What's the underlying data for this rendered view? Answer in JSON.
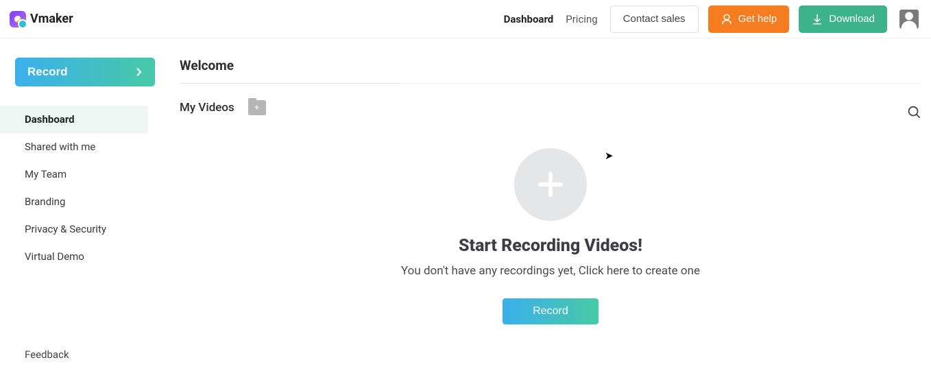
{
  "brand": {
    "name": "Vmaker"
  },
  "topnav": {
    "links": [
      {
        "label": "Dashboard",
        "active": true
      },
      {
        "label": "Pricing",
        "active": false
      }
    ],
    "contact_label": "Contact sales",
    "help_label": "Get help",
    "download_label": "Download"
  },
  "sidebar": {
    "primary_label": "Record",
    "items": [
      {
        "label": "Dashboard",
        "active": true
      },
      {
        "label": "Shared with me",
        "active": false
      },
      {
        "label": "My Team",
        "active": false
      },
      {
        "label": "Branding",
        "active": false
      },
      {
        "label": "Privacy & Security",
        "active": false
      },
      {
        "label": "Virtual Demo",
        "active": false
      }
    ],
    "feedback_label": "Feedback"
  },
  "main": {
    "welcome": "Welcome",
    "section_title": "My Videos",
    "empty": {
      "title": "Start Recording Videos!",
      "subtitle": "You don't have any recordings yet, Click here to create one",
      "cta": "Record"
    }
  }
}
